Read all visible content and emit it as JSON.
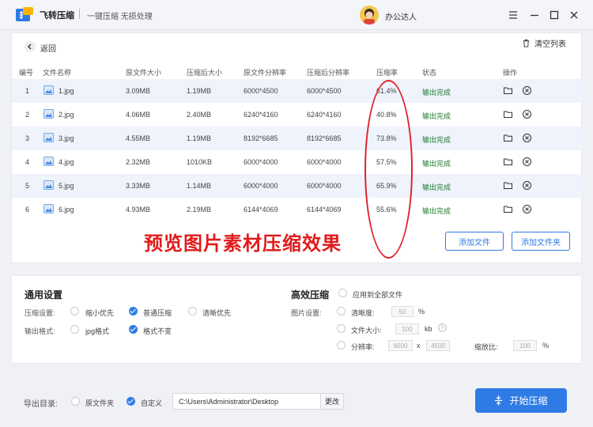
{
  "app": {
    "name": "飞转压缩",
    "slogan": "一键压缩 无损处理",
    "user": "办公达人",
    "accent": "#2f7be6"
  },
  "toolbar": {
    "back_label": "返回",
    "clear_label": "清空列表"
  },
  "table": {
    "headers": [
      "编号",
      "文件名称",
      "原文件大小",
      "压缩后大小",
      "原文件分辨率",
      "压缩后分辨率",
      "压缩率",
      "状态",
      "操作"
    ],
    "rows": [
      {
        "index": "1",
        "name": "1.jpg",
        "orig_size": "3.09MB",
        "new_size": "1.19MB",
        "orig_res": "6000*4500",
        "new_res": "6000*4500",
        "ratio": "61.4%",
        "status": "输出完成"
      },
      {
        "index": "2",
        "name": "2.jpg",
        "orig_size": "4.06MB",
        "new_size": "2.40MB",
        "orig_res": "6240*4160",
        "new_res": "6240*4160",
        "ratio": "40.8%",
        "status": "输出完成"
      },
      {
        "index": "3",
        "name": "3.jpg",
        "orig_size": "4.55MB",
        "new_size": "1.19MB",
        "orig_res": "8192*6685",
        "new_res": "8192*6685",
        "ratio": "73.8%",
        "status": "输出完成"
      },
      {
        "index": "4",
        "name": "4.jpg",
        "orig_size": "2.32MB",
        "new_size": "1010KB",
        "orig_res": "6000*4000",
        "new_res": "6000*4000",
        "ratio": "57.5%",
        "status": "输出完成"
      },
      {
        "index": "5",
        "name": "5.jpg",
        "orig_size": "3.33MB",
        "new_size": "1.14MB",
        "orig_res": "6000*4000",
        "new_res": "6000*4000",
        "ratio": "65.9%",
        "status": "输出完成"
      },
      {
        "index": "6",
        "name": "6.jpg",
        "orig_size": "4.93MB",
        "new_size": "2.19MB",
        "orig_res": "6144*4069",
        "new_res": "6144*4069",
        "ratio": "55.6%",
        "status": "输出完成"
      }
    ]
  },
  "overlay": {
    "caption": "预览图片素材压缩效果",
    "color": "#e11b1b"
  },
  "list_actions": {
    "add_file": "添加文件",
    "add_folder": "添加文件夹"
  },
  "general": {
    "title": "通用设置",
    "compress_label": "压缩设置:",
    "compress_options": [
      "缩小优先",
      "普通压缩",
      "清晰优先"
    ],
    "compress_selected": "普通压缩",
    "format_label": "输出格式:",
    "format_options": [
      "jpg格式",
      "格式不变"
    ],
    "format_selected": "格式不变"
  },
  "advanced": {
    "title": "高效压缩",
    "apply_all": "应用到全部文件",
    "image_label": "图片设置:",
    "clarity_label": "清晰度:",
    "clarity_value": "50",
    "clarity_unit": "%",
    "size_label": "文件大小:",
    "size_value": "100",
    "size_unit": "kb",
    "res_label": "分辨率:",
    "res_width": "6000",
    "res_sep": "x",
    "res_height": "4500",
    "scale_label": "缩放比:",
    "scale_value": "100",
    "scale_unit": "%"
  },
  "output": {
    "label": "导出目录:",
    "option_original": "原文件夹",
    "option_custom": "自定义",
    "selected": "自定义",
    "path": "C:\\Users\\Administrator\\Desktop",
    "change_label": "更改"
  },
  "start": {
    "label": "开始压缩"
  }
}
